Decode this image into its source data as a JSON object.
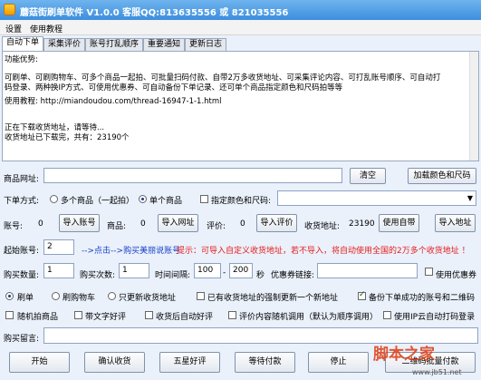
{
  "window": {
    "title": "蘑菇街刷单软件 V1.0.0 客服QQ:813635556 或 821035556"
  },
  "menu": [
    "设置",
    "使用教程"
  ],
  "tabs": [
    "自动下单",
    "采集评价",
    "账号打乱顺序",
    "重要通知",
    "更新日志"
  ],
  "log": {
    "lines": [
      "功能优势:",
      "",
      "可刷单、可刷购物车、可多个商品一起拍、可批量扫码付款、自带2万多收货地址、可采集评论内容、可打乱账号顺序、可自动打",
      "码登录、两种换IP方式、可使用优惠券、可自动备份下单记录、还可单个商品指定颜色和尺码拍等等",
      "",
      "使用教程: http://miandoudou.com/thread-16947-1-1.html",
      "",
      "",
      "正在下载收货地址，请等待...",
      "收货地址已下载完，共有：23190个"
    ]
  },
  "product_url": {
    "label": "商品网址:",
    "value": ""
  },
  "buttons": {
    "clear": "清空",
    "add_color_size": "加载颜色和尺码",
    "import_account": "导入账号",
    "import_url": "导入网址",
    "import_review": "导入评价",
    "use_own": "使用自带",
    "import_address": "导入地址",
    "start": "开始",
    "confirm_receipt": "确认收货",
    "five_star": "五星好评",
    "wait_pay": "等待付款",
    "stop": "停止",
    "qr_pay": "二维码批量付款"
  },
  "order_mode": {
    "label": "下单方式:",
    "multi": "多个商品（一起拍）",
    "single": "单个商品",
    "color_size": "指定颜色和尺码:",
    "color_size_value": ""
  },
  "counts": {
    "account_label": "账号:",
    "account_value": "0",
    "product_label": "商品:",
    "product_value": "0",
    "review_label": "评价:",
    "review_value": "0",
    "address_label": "收货地址:",
    "address_value": "23190"
  },
  "start_account": {
    "label": "起始账号:",
    "value": "2",
    "link": "-->点击-->购买美丽说账号",
    "tip": "提示：可导入自定义收货地址，若不导入，将自动使用全国的2万多个收货地址 ！"
  },
  "purchase": {
    "qty_label": "购买数量:",
    "qty_value": "1",
    "times_label": "购买次数:",
    "times_value": "1",
    "interval_label": "时间间隔:",
    "interval_from": "100",
    "interval_sep": "-",
    "interval_to": "200",
    "sec": "秒",
    "coupon_label": "优惠券链接:",
    "coupon_value": "",
    "use_coupon": "使用优惠券"
  },
  "action_options": {
    "brush": "刷单",
    "cart": "刷购物车",
    "update_address": "只更新收货地址",
    "force_new_address": "已有收货地址的强制更新一个新地址",
    "backup": "备份下单成功的账号和二维码"
  },
  "extra_options": {
    "random_pick": "随机拍商品",
    "blank_review": "带文字好评",
    "auto_review": "收货后自动好评",
    "random_review": "评价内容随机调用（默认为顺序调用）",
    "ip_login": "使用IP云自动打码登录"
  },
  "buyer_message": {
    "label": "购买留言:",
    "value": ""
  },
  "watermark": {
    "logo": "脚本之家",
    "url": "www.jb51.net"
  },
  "colors": {
    "title_bar": "#3d8ede",
    "tip_red": "#e51c1c",
    "link_blue": "#1840c8"
  }
}
